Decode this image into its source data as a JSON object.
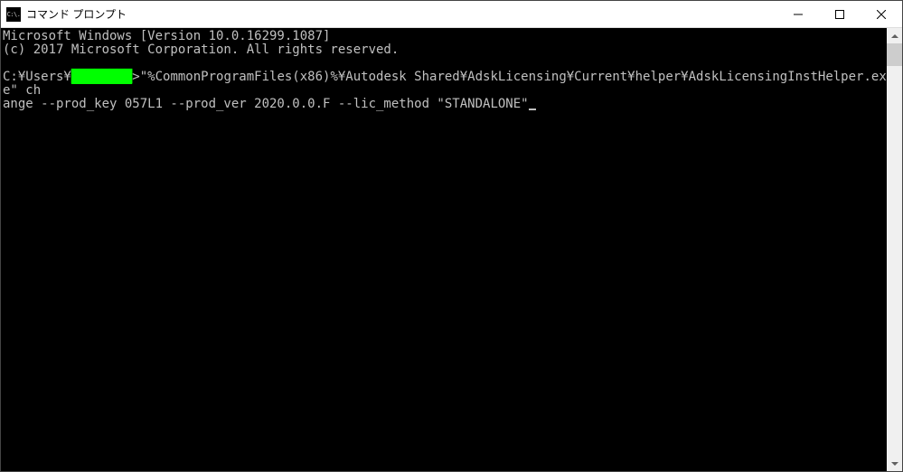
{
  "window": {
    "title": "コマンド プロンプト",
    "icon_text": "C:\\."
  },
  "console": {
    "line1": "Microsoft Windows [Version 10.0.16299.1087]",
    "line2": "(c) 2017 Microsoft Corporation. All rights reserved.",
    "blank": "",
    "prompt_prefix": "C:¥Users¥",
    "redacted_user": "████████",
    "prompt_suffix": ">",
    "command_part1": "\"%CommonProgramFiles(x86)%¥Autodesk Shared¥AdskLicensing¥Current¥helper¥AdskLicensingInstHelper.exe\" ch",
    "command_part2": "ange --prod_key 057L1 --prod_ver 2020.0.0.F --lic_method \"STANDALONE\""
  }
}
